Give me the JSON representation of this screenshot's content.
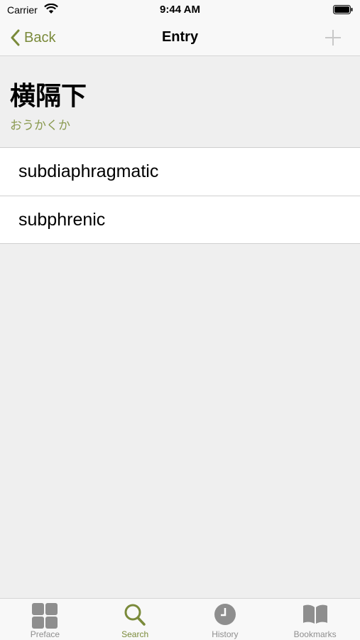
{
  "status_bar": {
    "carrier": "Carrier",
    "time": "9:44 AM"
  },
  "nav": {
    "back_label": "Back",
    "title": "Entry"
  },
  "entry": {
    "kanji": "横隔下",
    "reading": "おうかくか"
  },
  "translations": [
    "subdiaphragmatic",
    "subphrenic"
  ],
  "tabs": [
    {
      "label": "Preface",
      "icon": "grid-icon",
      "active": false
    },
    {
      "label": "Search",
      "icon": "search-icon",
      "active": true
    },
    {
      "label": "History",
      "icon": "clock-icon",
      "active": false
    },
    {
      "label": "Bookmarks",
      "icon": "book-icon",
      "active": false
    }
  ],
  "colors": {
    "accent": "#7a8a3a",
    "inactive": "#8e8e8e",
    "background": "#efefef"
  }
}
